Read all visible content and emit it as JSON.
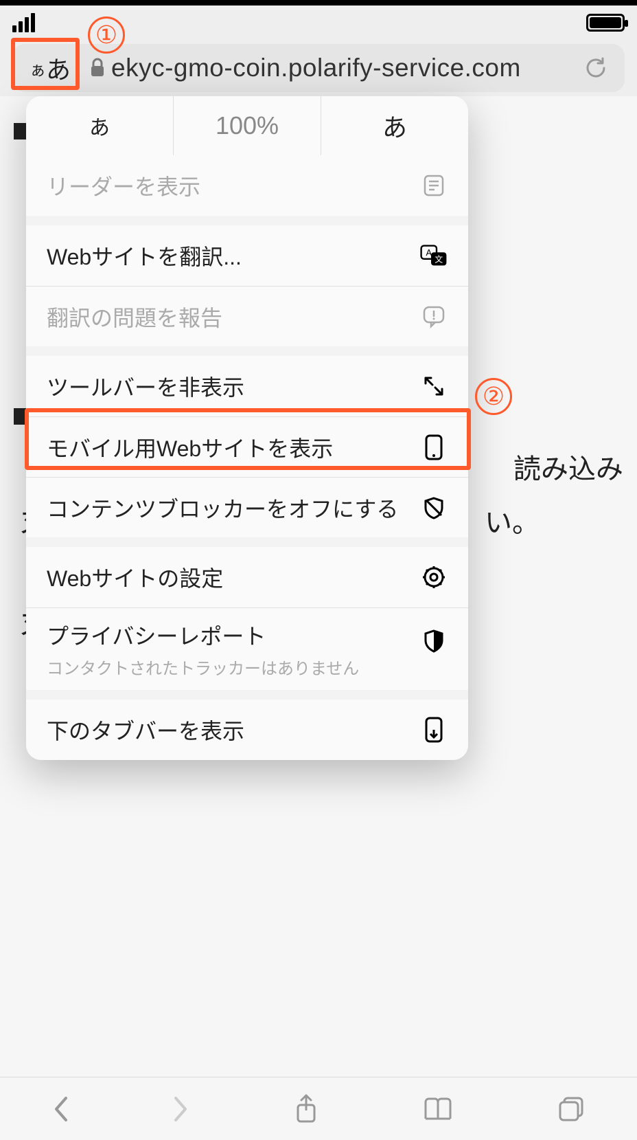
{
  "status": {
    "signal": 4,
    "battery": 100
  },
  "addressbar": {
    "aa_small": "ぁ",
    "aa_large": "あ",
    "url": "ekyc-gmo-coin.polarify-service.com"
  },
  "annotations": {
    "one": "①",
    "two": "②"
  },
  "zoom": {
    "decrease": "あ",
    "level": "100%",
    "increase": "あ"
  },
  "menu": {
    "reader": "リーダーを表示",
    "translate": "Webサイトを翻訳...",
    "report_translation": "翻訳の問題を報告",
    "hide_toolbar": "ツールバーを非表示",
    "mobile_site": "モバイル用Webサイトを表示",
    "content_blockers": "コンテンツブロッカーをオフにする",
    "site_settings": "Webサイトの設定",
    "privacy_report": "プライバシーレポート",
    "privacy_sub": "コンタクトされたトラッカーはありません",
    "tab_bar_bottom": "下のタブバーを表示"
  },
  "background_page": {
    "text_right": "読み込み",
    "text_tail": "い。",
    "kana_xi": "ヌ"
  },
  "icons": {
    "lock": "lock",
    "reload": "reload",
    "reader": "reader",
    "translate": "translate",
    "report": "report",
    "expand": "expand",
    "phone": "phone",
    "shield_off": "shield-off",
    "gear": "gear",
    "shield": "shield",
    "tabbar": "tabbar-bottom",
    "back": "back",
    "forward": "forward",
    "share": "share",
    "book": "book",
    "tabs": "tabs"
  }
}
